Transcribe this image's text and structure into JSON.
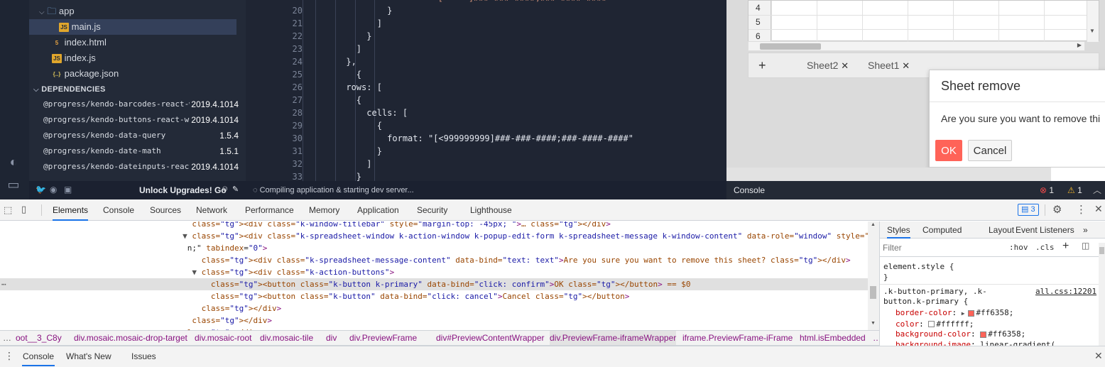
{
  "explorer": {
    "tree": [
      {
        "label": "app",
        "type": "folder"
      },
      {
        "label": "main.js",
        "type": "js",
        "selected": true
      },
      {
        "label": "index.html",
        "type": "html"
      },
      {
        "label": "index.js",
        "type": "js"
      },
      {
        "label": "package.json",
        "type": "json"
      }
    ],
    "dependencies_title": "DEPENDENCIES",
    "dependencies": [
      {
        "name": "@progress/kendo-barcodes-react-wr",
        "version": "2019.4.1014"
      },
      {
        "name": "@progress/kendo-buttons-react-wra",
        "version": "2019.4.1014"
      },
      {
        "name": "@progress/kendo-data-query",
        "version": "1.5.4"
      },
      {
        "name": "@progress/kendo-date-math",
        "version": "1.5.1"
      },
      {
        "name": "@progress/kendo-dateinputs-react-",
        "version": "2019.4.1014"
      }
    ],
    "footer_text": "Unlock Upgrades! Go"
  },
  "editor": {
    "line_numbers": [
      "20",
      "21",
      "22",
      "23",
      "24",
      "25",
      "26",
      "27",
      "28",
      "29",
      "30",
      "31",
      "32",
      "33"
    ],
    "top_partial": "       [     ]###-###-####;###-####-####",
    "lines": [
      "              }",
      "            ]",
      "          }",
      "        ]",
      "      },",
      "        {",
      "      rows: [",
      "        {",
      "          cells: [",
      "            {",
      "              format: \"[<999999999]###-###-####;###-####-####\"",
      "            }",
      "          ]",
      "        }"
    ],
    "status": "Compiling application & starting dev server..."
  },
  "preview": {
    "row_headers": [
      "4",
      "5",
      "6"
    ],
    "sheet_tabs": [
      {
        "label": "Sheet2"
      },
      {
        "label": "Sheet1"
      }
    ],
    "dialog": {
      "title": "Sheet remove",
      "message": "Are you sure you want to remove thi",
      "ok": "OK",
      "cancel": "Cancel"
    },
    "console_label": "Console",
    "errors": "1",
    "warnings": "1"
  },
  "devtools": {
    "tabs": [
      "Elements",
      "Console",
      "Sources",
      "Network",
      "Performance",
      "Memory",
      "Application",
      "Security",
      "Lighthouse"
    ],
    "active_tab": "Elements",
    "issues_count": "3",
    "dom": [
      {
        "indent": "      ",
        "text": "<div class=\"k-window-titlebar\" style=\"margin-top: -45px; \">…</div>"
      },
      {
        "indent": "     ▼",
        "text": "<div class=\"k-spreadsheet-window k-action-window k-popup-edit-form k-spreadsheet-message k-window-content\" data-role=\"window\" style=\"overflow: hidde"
      },
      {
        "indent": "      ",
        "text": "n;\" tabindex=\"0\">"
      },
      {
        "indent": "        ",
        "text": "<div class=\"k-spreadsheet-message-content\" data-bind=\"text: text\">Are you sure you want to remove this sheet?</div>"
      },
      {
        "indent": "       ▼",
        "text": "<div class=\"k-action-buttons\">"
      },
      {
        "indent": "          ",
        "text": "<button class=\"k-button k-primary\" data-bind=\"click: confirm\">OK</button> == $0",
        "highlight": true
      },
      {
        "indent": "          ",
        "text": "<button class=\"k-button\" data-bind=\"click: cancel\">Cancel</button>"
      },
      {
        "indent": "        ",
        "text": "</div>"
      },
      {
        "indent": "      ",
        "text": "</div>"
      },
      {
        "indent": "    ",
        "text": "</div>"
      }
    ],
    "breadcrumbs": [
      "oot__3_C8y",
      "div.mosaic.mosaic-drop-target",
      "div.mosaic-root",
      "div.mosaic-tile",
      "div",
      "div.PreviewFrame",
      "div#PreviewContentWrapper",
      "div.PreviewFrame-iframeWrapper",
      "iframe.PreviewFrame-iFrame",
      "html.isEmbedded",
      "…"
    ],
    "styles_tabs": [
      "Styles",
      "Computed",
      "Layout",
      "Event Listeners",
      "»"
    ],
    "filter_placeholder": "Filter",
    "hov": ":hov",
    "cls": ".cls",
    "element_style": "element.style {",
    "close_brace": "}",
    "rule_selector": ".k-button-primary, .k-button.k-primary {",
    "rule_source": "all.css:12201",
    "props": [
      {
        "name": "border-color",
        "value": "#ff6358;",
        "swatch": "#ff6358",
        "arrow": true
      },
      {
        "name": "color",
        "value": "#ffffff;",
        "swatch": "#ffffff"
      },
      {
        "name": "background-color",
        "value": "#ff6358;",
        "swatch": "#ff6358"
      },
      {
        "name": "background-image",
        "value": "linear-gradient("
      }
    ],
    "drawer_tabs": [
      "Console",
      "What's New",
      "Issues"
    ]
  }
}
